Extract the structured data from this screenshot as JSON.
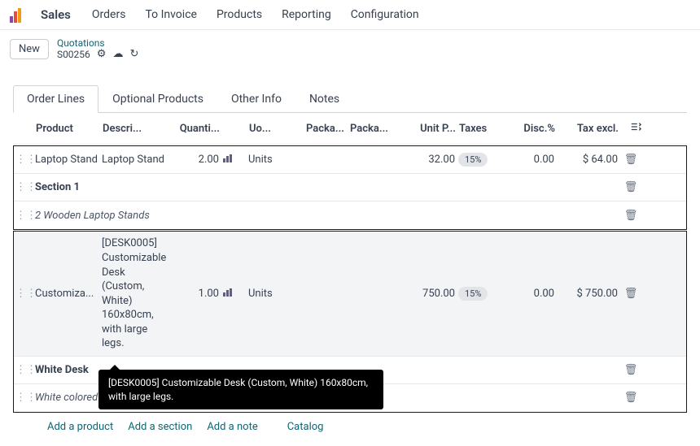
{
  "app": {
    "title": "Sales"
  },
  "nav": {
    "orders": "Orders",
    "toinvoice": "To Invoice",
    "products": "Products",
    "reporting": "Reporting",
    "config": "Configuration"
  },
  "breadcrumb": {
    "newBtn": "New",
    "top": "Quotations",
    "record": "S00256"
  },
  "tabs": {
    "orderlines": "Order Lines",
    "optional": "Optional Products",
    "other": "Other Info",
    "notes": "Notes"
  },
  "columns": {
    "product": "Product",
    "descr": "Descri...",
    "qty": "Quanti...",
    "uom": "Uo...",
    "pkg1": "Packa...",
    "pkg2": "Packa...",
    "unitp": "Unit P...",
    "taxes": "Taxes",
    "disc": "Disc.%",
    "taxexcl": "Tax excl."
  },
  "rows": {
    "r1": {
      "product": "Laptop Stand",
      "descr": "Laptop Stand",
      "qty": "2.00",
      "uom": "Units",
      "unitp": "32.00",
      "tax": "15%",
      "disc": "0.00",
      "taxexcl": "$ 64.00"
    },
    "section1": "Section 1",
    "note1": "2 Wooden Laptop Stands",
    "r2": {
      "product": "Customiza...",
      "descr": "[DESK0005] Customizable Desk (Custom, White) 160x80cm, with large legs.",
      "qty": "1.00",
      "uom": "Units",
      "unitp": "750.00",
      "tax": "15%",
      "disc": "0.00",
      "taxexcl": "$ 750.00"
    },
    "section2": "White Desk",
    "note2": "White colored customizable desk"
  },
  "tooltip": "[DESK0005] Customizable Desk (Custom, White) 160x80cm, with large legs.",
  "actions": {
    "addprod": "Add a product",
    "addsect": "Add a section",
    "addnote": "Add a note",
    "catalog": "Catalog"
  }
}
